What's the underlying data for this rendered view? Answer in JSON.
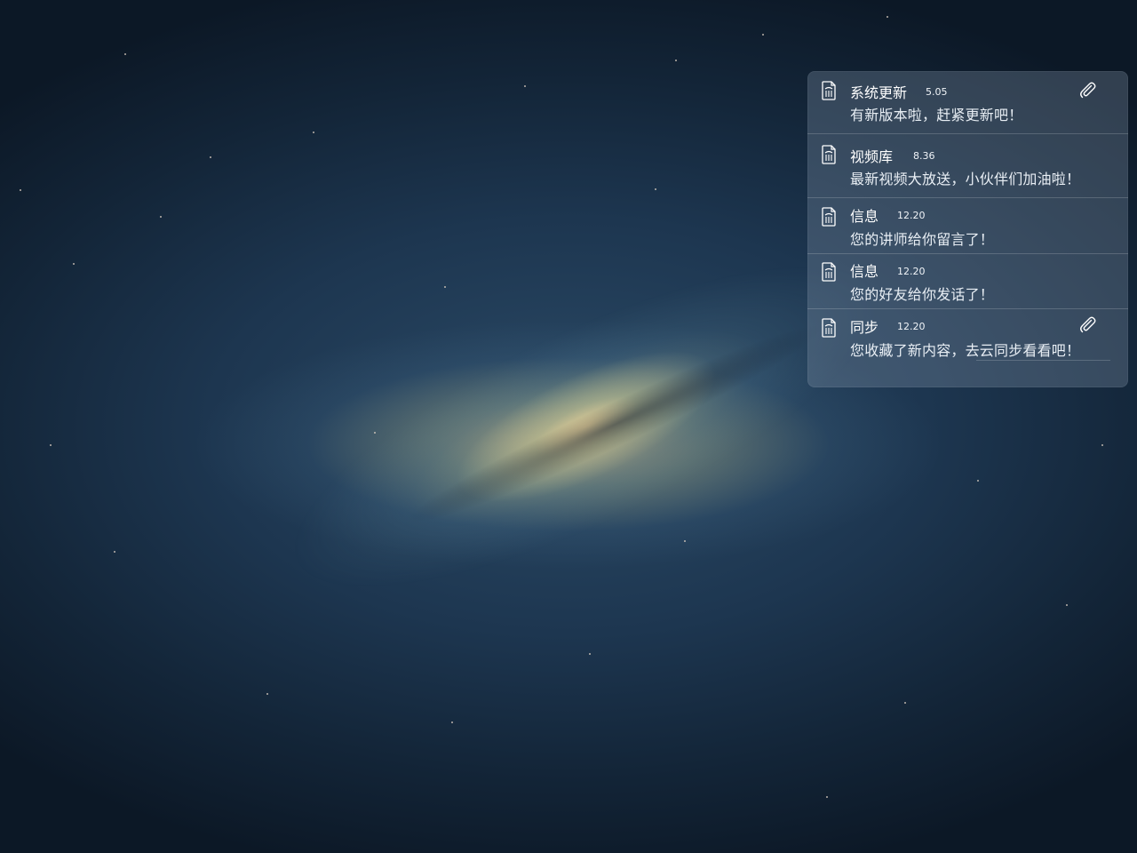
{
  "notifications": [
    {
      "title": "系统更新",
      "time": "5.05",
      "message": "有新版本啦，赶紧更新吧！",
      "attachment": true,
      "icon": "document-icon"
    },
    {
      "title": "视频库",
      "time": "8.36",
      "message": "最新视频大放送，小伙伴们加油啦！",
      "attachment": false,
      "icon": "document-icon"
    },
    {
      "title": "信息",
      "time": "12.20",
      "message": "您的讲师给你留言了！",
      "attachment": false,
      "icon": "document-icon"
    },
    {
      "title": "信息",
      "time": "12.20",
      "message": "您的好友给你发话了！",
      "attachment": false,
      "icon": "document-icon"
    },
    {
      "title": "同步",
      "time": "12.20",
      "message": "您收藏了新内容，去云同步看看吧！",
      "attachment": true,
      "icon": "document-icon"
    }
  ],
  "colors": {
    "panel_bg": "#8296aa",
    "text": "#ffffff",
    "wallpaper_dark": "#0c1826",
    "wallpaper_mid": "#1d3650"
  }
}
